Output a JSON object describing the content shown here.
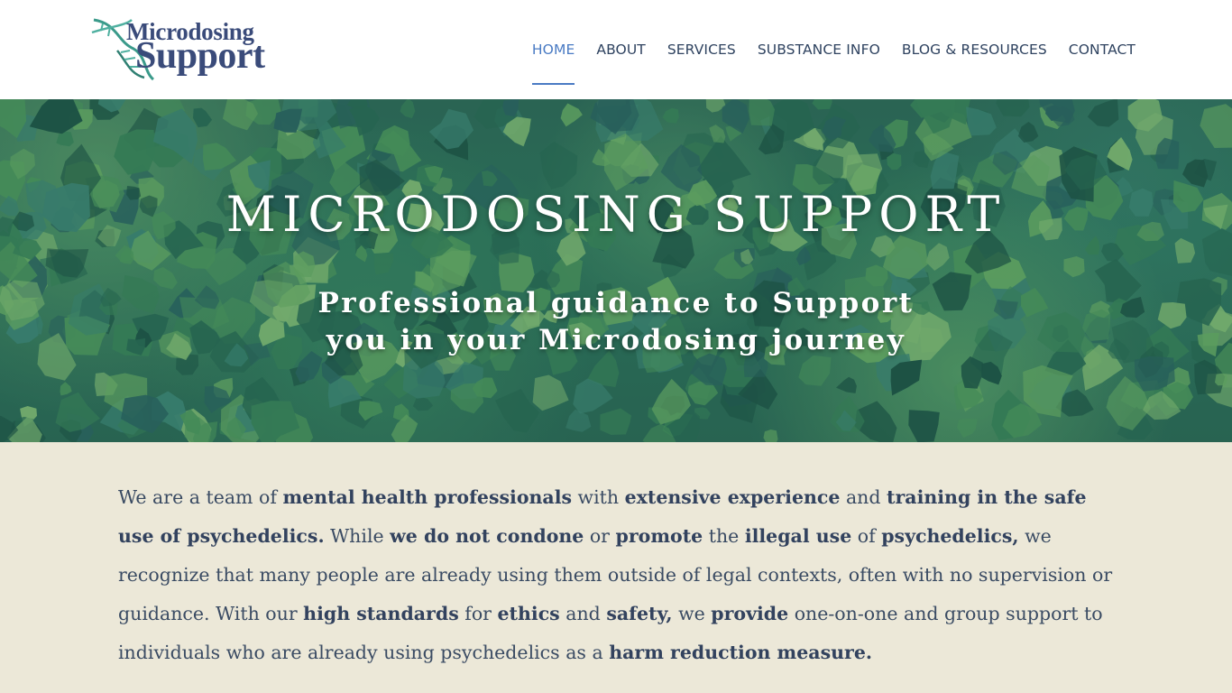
{
  "brand": {
    "logo_line1": "Microdosing",
    "logo_line2": "Support",
    "colors": {
      "primary": "#3a4b7a",
      "accent": "#4a7bc4",
      "helix": "#3a9a8a",
      "intro_bg": "#ece8d8"
    }
  },
  "nav": {
    "items": [
      {
        "label": "HOME",
        "active": true
      },
      {
        "label": "ABOUT"
      },
      {
        "label": "SERVICES"
      },
      {
        "label": "SUBSTANCE INFO"
      },
      {
        "label": "BLOG & RESOURCES"
      },
      {
        "label": "CONTACT"
      }
    ]
  },
  "hero": {
    "title": "MICRODOSING SUPPORT",
    "subtitle_line1": "Professional guidance to Support",
    "subtitle_line2": "you in your Microdosing journey",
    "background": "forest-aerial-image"
  },
  "intro": {
    "segments": [
      {
        "t": "We are a team of ",
        "b": false
      },
      {
        "t": "mental health professionals",
        "b": true
      },
      {
        "t": " with ",
        "b": false
      },
      {
        "t": "extensive experience",
        "b": true
      },
      {
        "t": " and ",
        "b": false
      },
      {
        "t": "training in the safe use of psychedelics.",
        "b": true
      },
      {
        "t": " While ",
        "b": false
      },
      {
        "t": "we do not condone",
        "b": true
      },
      {
        "t": " or ",
        "b": false
      },
      {
        "t": "promote",
        "b": true
      },
      {
        "t": " the ",
        "b": false
      },
      {
        "t": "illegal use",
        "b": true
      },
      {
        "t": " of ",
        "b": false
      },
      {
        "t": "psychedelics,",
        "b": true
      },
      {
        "t": " we recognize that many people are already using them outside of legal contexts, often with no supervision or guidance. With our ",
        "b": false
      },
      {
        "t": "high standards",
        "b": true
      },
      {
        "t": " for ",
        "b": false
      },
      {
        "t": "ethics",
        "b": true
      },
      {
        "t": " and ",
        "b": false
      },
      {
        "t": "safety,",
        "b": true
      },
      {
        "t": " we ",
        "b": false
      },
      {
        "t": "provide",
        "b": true
      },
      {
        "t": " one-on-one and group support to individuals who are already using psychedelics as a ",
        "b": false
      },
      {
        "t": "harm reduction measure.",
        "b": true
      }
    ]
  }
}
